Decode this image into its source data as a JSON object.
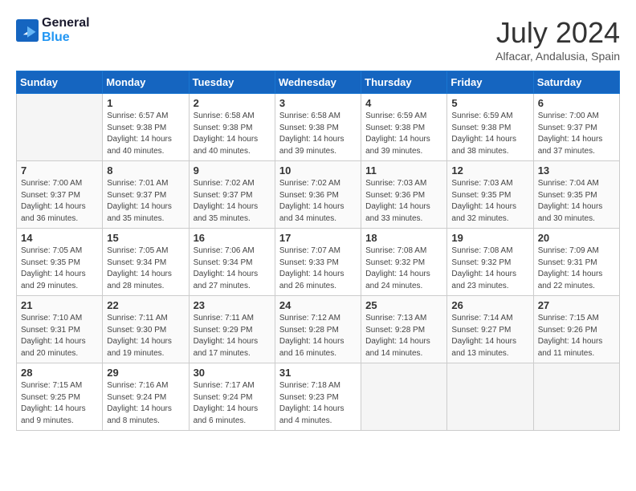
{
  "logo": {
    "line1": "General",
    "line2": "Blue"
  },
  "title": "July 2024",
  "location": "Alfacar, Andalusia, Spain",
  "days_header": [
    "Sunday",
    "Monday",
    "Tuesday",
    "Wednesday",
    "Thursday",
    "Friday",
    "Saturday"
  ],
  "weeks": [
    [
      {
        "day": "",
        "info": ""
      },
      {
        "day": "1",
        "info": "Sunrise: 6:57 AM\nSunset: 9:38 PM\nDaylight: 14 hours\nand 40 minutes."
      },
      {
        "day": "2",
        "info": "Sunrise: 6:58 AM\nSunset: 9:38 PM\nDaylight: 14 hours\nand 40 minutes."
      },
      {
        "day": "3",
        "info": "Sunrise: 6:58 AM\nSunset: 9:38 PM\nDaylight: 14 hours\nand 39 minutes."
      },
      {
        "day": "4",
        "info": "Sunrise: 6:59 AM\nSunset: 9:38 PM\nDaylight: 14 hours\nand 39 minutes."
      },
      {
        "day": "5",
        "info": "Sunrise: 6:59 AM\nSunset: 9:38 PM\nDaylight: 14 hours\nand 38 minutes."
      },
      {
        "day": "6",
        "info": "Sunrise: 7:00 AM\nSunset: 9:37 PM\nDaylight: 14 hours\nand 37 minutes."
      }
    ],
    [
      {
        "day": "7",
        "info": "Sunrise: 7:00 AM\nSunset: 9:37 PM\nDaylight: 14 hours\nand 36 minutes."
      },
      {
        "day": "8",
        "info": "Sunrise: 7:01 AM\nSunset: 9:37 PM\nDaylight: 14 hours\nand 35 minutes."
      },
      {
        "day": "9",
        "info": "Sunrise: 7:02 AM\nSunset: 9:37 PM\nDaylight: 14 hours\nand 35 minutes."
      },
      {
        "day": "10",
        "info": "Sunrise: 7:02 AM\nSunset: 9:36 PM\nDaylight: 14 hours\nand 34 minutes."
      },
      {
        "day": "11",
        "info": "Sunrise: 7:03 AM\nSunset: 9:36 PM\nDaylight: 14 hours\nand 33 minutes."
      },
      {
        "day": "12",
        "info": "Sunrise: 7:03 AM\nSunset: 9:35 PM\nDaylight: 14 hours\nand 32 minutes."
      },
      {
        "day": "13",
        "info": "Sunrise: 7:04 AM\nSunset: 9:35 PM\nDaylight: 14 hours\nand 30 minutes."
      }
    ],
    [
      {
        "day": "14",
        "info": "Sunrise: 7:05 AM\nSunset: 9:35 PM\nDaylight: 14 hours\nand 29 minutes."
      },
      {
        "day": "15",
        "info": "Sunrise: 7:05 AM\nSunset: 9:34 PM\nDaylight: 14 hours\nand 28 minutes."
      },
      {
        "day": "16",
        "info": "Sunrise: 7:06 AM\nSunset: 9:34 PM\nDaylight: 14 hours\nand 27 minutes."
      },
      {
        "day": "17",
        "info": "Sunrise: 7:07 AM\nSunset: 9:33 PM\nDaylight: 14 hours\nand 26 minutes."
      },
      {
        "day": "18",
        "info": "Sunrise: 7:08 AM\nSunset: 9:32 PM\nDaylight: 14 hours\nand 24 minutes."
      },
      {
        "day": "19",
        "info": "Sunrise: 7:08 AM\nSunset: 9:32 PM\nDaylight: 14 hours\nand 23 minutes."
      },
      {
        "day": "20",
        "info": "Sunrise: 7:09 AM\nSunset: 9:31 PM\nDaylight: 14 hours\nand 22 minutes."
      }
    ],
    [
      {
        "day": "21",
        "info": "Sunrise: 7:10 AM\nSunset: 9:31 PM\nDaylight: 14 hours\nand 20 minutes."
      },
      {
        "day": "22",
        "info": "Sunrise: 7:11 AM\nSunset: 9:30 PM\nDaylight: 14 hours\nand 19 minutes."
      },
      {
        "day": "23",
        "info": "Sunrise: 7:11 AM\nSunset: 9:29 PM\nDaylight: 14 hours\nand 17 minutes."
      },
      {
        "day": "24",
        "info": "Sunrise: 7:12 AM\nSunset: 9:28 PM\nDaylight: 14 hours\nand 16 minutes."
      },
      {
        "day": "25",
        "info": "Sunrise: 7:13 AM\nSunset: 9:28 PM\nDaylight: 14 hours\nand 14 minutes."
      },
      {
        "day": "26",
        "info": "Sunrise: 7:14 AM\nSunset: 9:27 PM\nDaylight: 14 hours\nand 13 minutes."
      },
      {
        "day": "27",
        "info": "Sunrise: 7:15 AM\nSunset: 9:26 PM\nDaylight: 14 hours\nand 11 minutes."
      }
    ],
    [
      {
        "day": "28",
        "info": "Sunrise: 7:15 AM\nSunset: 9:25 PM\nDaylight: 14 hours\nand 9 minutes."
      },
      {
        "day": "29",
        "info": "Sunrise: 7:16 AM\nSunset: 9:24 PM\nDaylight: 14 hours\nand 8 minutes."
      },
      {
        "day": "30",
        "info": "Sunrise: 7:17 AM\nSunset: 9:24 PM\nDaylight: 14 hours\nand 6 minutes."
      },
      {
        "day": "31",
        "info": "Sunrise: 7:18 AM\nSunset: 9:23 PM\nDaylight: 14 hours\nand 4 minutes."
      },
      {
        "day": "",
        "info": ""
      },
      {
        "day": "",
        "info": ""
      },
      {
        "day": "",
        "info": ""
      }
    ]
  ]
}
